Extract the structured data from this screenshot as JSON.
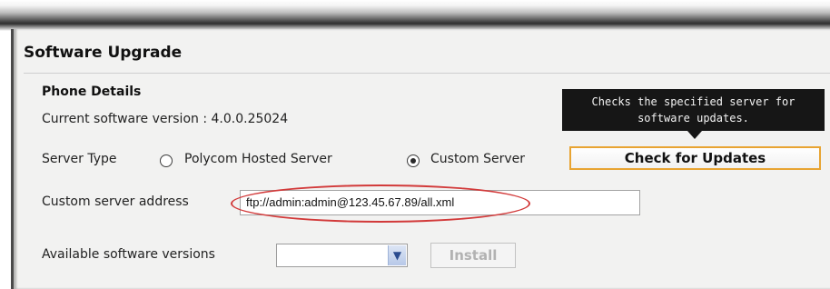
{
  "panel": {
    "title": "Software Upgrade",
    "section_title": "Phone Details",
    "current_version_label": "Current software version : 4.0.0.25024"
  },
  "tooltip": {
    "text_line1": "Checks the specified server for",
    "text_line2": "software updates."
  },
  "server_type": {
    "label": "Server Type",
    "options": [
      {
        "label": "Polycom Hosted Server",
        "selected": false
      },
      {
        "label": "Custom Server",
        "selected": true
      }
    ]
  },
  "check_updates_button": {
    "label": "Check for Updates"
  },
  "custom_server": {
    "label": "Custom server address",
    "value": "ftp://admin:admin@123.45.67.89/all.xml"
  },
  "available_versions": {
    "label": "Available software versions",
    "selected_value": ""
  },
  "install_button": {
    "label": "Install",
    "enabled": false
  },
  "colors": {
    "highlight_ellipse": "#d23a3a",
    "button_border": "#e8a432",
    "tooltip_bg": "#161616"
  }
}
